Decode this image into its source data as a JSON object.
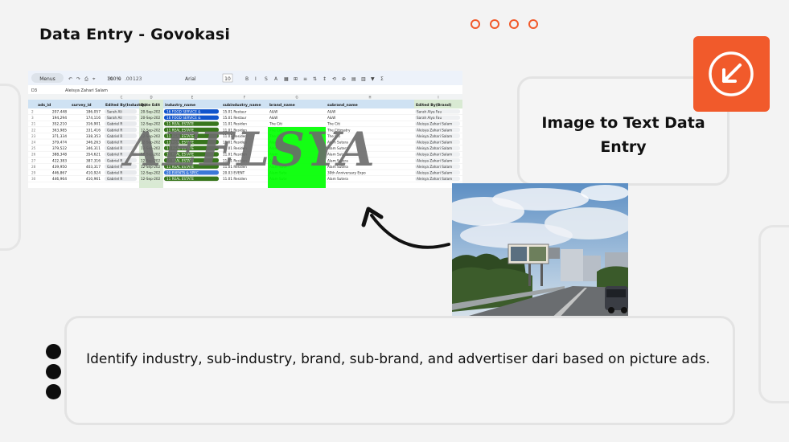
{
  "slide": {
    "title": "Data Entry - Govokasi",
    "card_right_text": "Image to Text Data Entry",
    "description": "Identify industry, sub-industry, brand, sub-brand, and advertiser dari based on picture ads."
  },
  "watermark": "AEELSYA",
  "spreadsheet": {
    "toolbar": {
      "menus": "Menus",
      "zoom": "100%",
      "font": "Arial",
      "font_size": "10"
    },
    "cell_ref": "D3",
    "formula_value": "Aleisya Zahari Salam",
    "columns": [
      "C",
      "D",
      "E",
      "F",
      "G",
      "H",
      "I"
    ],
    "headers": [
      "ads_id",
      "survey_id",
      "Edited By(Industry)",
      "Date Edit",
      "industry_name",
      "subindustry_name",
      "brand_name",
      "subrand_name",
      "Edited By(Brand)"
    ],
    "rows": [
      {
        "n": "2",
        "ads": "207,448",
        "survey": "186,057",
        "edited": "Sarah Ali",
        "date": "20-Sep-202",
        "industry": "16 FOOD SERVICE &",
        "sub": "15.01 Restaur",
        "brand": "A&W",
        "subrand": "A&W",
        "editedb": "Sarah Alya Fau"
      },
      {
        "n": "3",
        "ads": "194,294",
        "survey": "174,116",
        "edited": "Sarah Ali",
        "date": "20-Sep-202",
        "industry": "16 FOOD SERVICE &",
        "sub": "15.01 Restaur",
        "brand": "A&W",
        "subrand": "A&W",
        "editedb": "Sarah Alya Fau"
      },
      {
        "n": "21",
        "ads": "352,210",
        "survey": "316,901",
        "edited": "Gabriel R",
        "date": "12-Sep-202",
        "industry": "11 REAL ESTATE",
        "sub": "11.01 Residen",
        "brand": "The Citi",
        "subrand": "The Citi",
        "editedb": "Aleisya Zahari Salam"
      },
      {
        "n": "22",
        "ads": "363,985",
        "survey": "331,416",
        "edited": "Gabriel R",
        "date": "12-Sep-202",
        "industry": "11 REAL ESTATE",
        "sub": "11.01 Residen",
        "brand": "The Citi",
        "subrand": "The Citimatry",
        "editedb": "Aleisya Zahari Salam"
      },
      {
        "n": "23",
        "ads": "371,334",
        "survey": "338,353",
        "edited": "Gabriel R",
        "date": "12-Sep-202",
        "industry": "11 REAL ESTATE",
        "sub": "11.01 Residen",
        "brand": "The Citi",
        "subrand": "The Citi",
        "editedb": "Aleisya Zahari Salam"
      },
      {
        "n": "24",
        "ads": "379,474",
        "survey": "346,263",
        "edited": "Gabriel R",
        "date": "12-Sep-202",
        "industry": "11 REAL ESTATE",
        "sub": "11.01 Residen",
        "brand": "Alam",
        "subrand": "Alam Sutera",
        "editedb": "Aleisya Zahari Salam"
      },
      {
        "n": "25",
        "ads": "379,522",
        "survey": "346,311",
        "edited": "Gabriel R",
        "date": "12-Sep-202",
        "industry": "11 REAL ESTATE",
        "sub": "11.01 Residen",
        "brand": "Alam",
        "subrand": "Alam Sutera",
        "editedb": "Aleisya Zahari Salam"
      },
      {
        "n": "26",
        "ads": "388,348",
        "survey": "354,621",
        "edited": "Gabriel R",
        "date": "12-Sep-202",
        "industry": "11 REAL ESTATE",
        "sub": "11.01 Residen",
        "brand": "Alam",
        "subrand": "Alam Sutera",
        "editedb": "Aleisya Zahari Salam"
      },
      {
        "n": "27",
        "ads": "422,383",
        "survey": "387,316",
        "edited": "Gabriel R",
        "date": "12-Sep-202",
        "industry": "11 REAL ESTATE",
        "sub": "11.01 Residen",
        "brand": "Alam",
        "subrand": "Alam Sutera",
        "editedb": "Aleisya Zahari Salam"
      },
      {
        "n": "28",
        "ads": "439,950",
        "survey": "403,317",
        "edited": "Gabriel R",
        "date": "12-Sep-202",
        "industry": "11 REAL ESTATE",
        "sub": "11.01 Residen",
        "brand": "Alam Sute",
        "subrand": "Alam Sutera",
        "editedb": "Aleisya Zahari Salam"
      },
      {
        "n": "29",
        "ads": "446,867",
        "survey": "410,924",
        "edited": "Gabriel R",
        "date": "12-Sep-202",
        "industry": "20 EVENTS & SPEC",
        "sub": "20.03 EVENT",
        "brand": "Alam Sute",
        "subrand": "30th Anniversary Expo",
        "editedb": "Aleisya Zahari Salam"
      },
      {
        "n": "30",
        "ads": "446,964",
        "survey": "410,961",
        "edited": "Gabriel R",
        "date": "12-Sep-202",
        "industry": "11 REAL ESTATE",
        "sub": "11.01 Residen",
        "brand": "Alam Sute",
        "subrand": "Alam Sutera",
        "editedb": "Aleisya Zahari Salam"
      }
    ]
  }
}
